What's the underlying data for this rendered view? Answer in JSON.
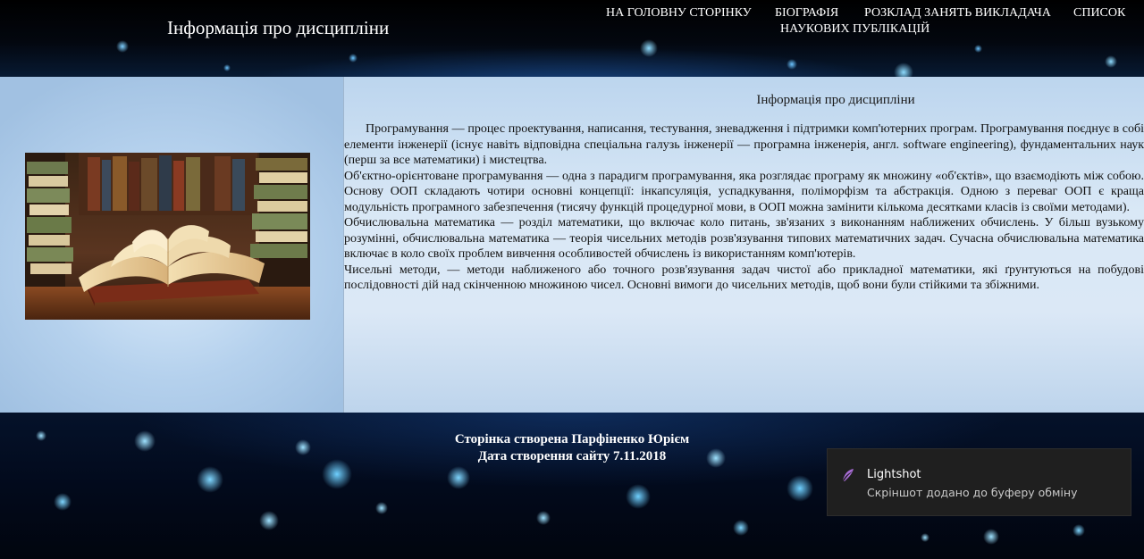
{
  "header": {
    "site_title": "Інформація про дисципліни",
    "nav": {
      "home": "На головну сторінку",
      "biography": "Біографія",
      "schedule": "Розклад занять викладача",
      "publications_line1": "Список",
      "publications_line2": "наукових публікацій"
    }
  },
  "main": {
    "image_alt": "books",
    "content_title": "Інформація про дисципліни",
    "paragraphs": [
      "Програмування — процес проектування, написання, тестування, зневадження і підтримки комп'ютерних програм. Програмування поєднує в собі елементи інженерії (існує навіть відповідна спеціальна галузь інженерії — програмна інженерія, англ. software engineering), фундаментальних наук (перш за все математики) і мистецтва.",
      "Об'єктно-орієнтоване програмування — одна з парадигм програмування, яка розглядає програму як множину «об'єктів», що взаємодіють між собою. Основу ООП складають чотири основні концепції: інкапсуляція, успадкування, поліморфізм та абстракція. Одною з переваг ООП є краща модульність програмного забезпечення (тисячу функцій процедурної мови, в ООП можна замінити кількома десятками класів із своїми методами).",
      "Обчислювальна математика — розділ математики, що включає коло питань, зв'язаних з виконанням наближених обчислень. У більш вузькому розумінні, обчислювальна математика — теорія чисельних методів розв'язування типових математичних задач. Сучасна обчислювальна математика включає в коло своїх проблем вивчення особливостей обчислень із використанням комп'ютерів.",
      "Чисельні методи, — методи наближеного або точного розв'язування задач чистої або прикладної математики, які ґрунтуються на побудові послідовності дій над скінченною множиною чисел. Основні вимоги до чисельних методів, щоб вони були стійкими та збіжними."
    ]
  },
  "footer": {
    "created_by": "Сторінка створена Парфіненко Юрієм",
    "created_date": "Дата створення сайту 7.11.2018"
  },
  "toast": {
    "app": "Lightshot",
    "message": "Скріншот додано до буферу обміну",
    "accent_color": "#a66bd3"
  },
  "colors": {
    "header_bg": "#03070f",
    "panel_bg": "#c7dcf1",
    "footer_bg": "#020a1c",
    "bokeh": "#2fa4ff"
  }
}
